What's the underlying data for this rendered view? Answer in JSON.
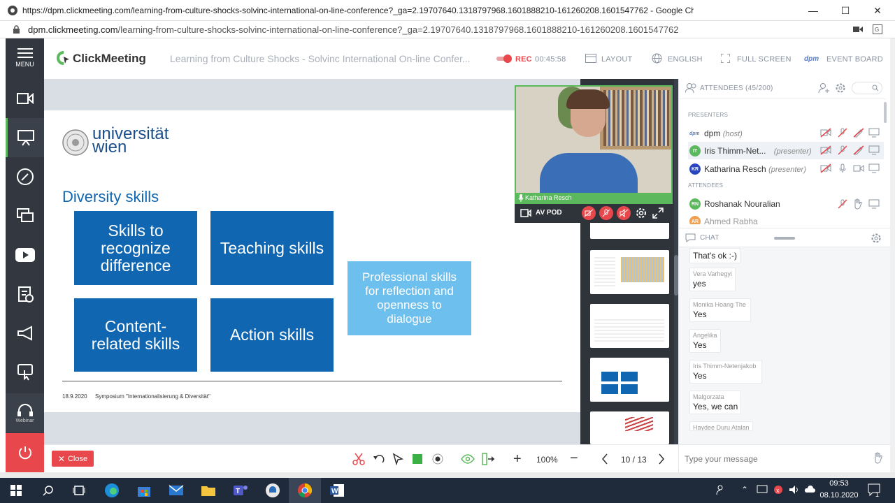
{
  "browser": {
    "title": "https://dpm.clickmeeting.com/learning-from-culture-shocks-solvinc-international-on-line-conference?_ga=2.19707640.1318797968.1601888210-161260208.1601547762 - Google Chrome",
    "url_domain": "dpm.clickmeeting.com",
    "url_path": "/learning-from-culture-shocks-solvinc-international-on-line-conference?_ga=2.19707640.1318797968.1601888210-161260208.1601547762"
  },
  "menu": {
    "label": "MENU",
    "webinar_label": "Webinar"
  },
  "header": {
    "logo": "ClickMeeting",
    "event_title": "Learning from Culture Shocks - Solvinc International On-line Confer...",
    "rec_label": "REC",
    "timer": "00:45:58",
    "layout_label": "LAYOUT",
    "language_label": "ENGLISH",
    "fullscreen_label": "FULL SCREEN",
    "eventboard_label": "EVENT BOARD"
  },
  "slide": {
    "uni_line1": "universität",
    "uni_line2": "wien",
    "heading": "Diversity skills",
    "box1": "Skills to recognize difference",
    "box2": "Teaching skills",
    "box3": "Content-related skills",
    "box4": "Action skills",
    "box5": "Professional skills for reflection and openness to dialogue",
    "footer_date": "18.9.2020",
    "footer_text": "Symposium \"Internationalisierung & Diversität\""
  },
  "video": {
    "speaker": "Katharina Resch",
    "av_pod_label": "AV POD"
  },
  "attendees": {
    "title": "ATTENDEES (45/200)",
    "presenters_label": "PRESENTERS",
    "attendees_label": "ATTENDEES",
    "presenters": [
      {
        "initials": "",
        "name": "dpm",
        "role": "(host)"
      },
      {
        "initials": "IT",
        "name": "Iris Thimm-Net...",
        "role": "(presenter)"
      },
      {
        "initials": "KR",
        "name": "Katharina Resch",
        "role": "(presenter)"
      }
    ],
    "list": [
      {
        "initials": "RN",
        "name": "Roshanak Nouralian"
      },
      {
        "initials": "AR",
        "name": "Ahmed Rabha"
      }
    ]
  },
  "chat": {
    "title": "CHAT",
    "messages": [
      {
        "name": "",
        "text": "That's ok :-)"
      },
      {
        "name": "Vera Varhegyi",
        "text": "yes"
      },
      {
        "name": "Monika Hoang The",
        "text": "Yes"
      },
      {
        "name": "Angelika",
        "text": "Yes"
      },
      {
        "name": "Iris Thimm-Netenjakob",
        "text": "Yes"
      },
      {
        "name": "Malgorzata",
        "text": "Yes, we can"
      },
      {
        "name": "Haydee Duru Atalan",
        "text": ""
      }
    ],
    "placeholder": "Type your message"
  },
  "toolbar": {
    "close_label": "Close",
    "zoom": "100%",
    "page": "10 / 13"
  },
  "taskbar": {
    "time": "09:53",
    "date": "08.10.2020",
    "notif_count": "1"
  }
}
